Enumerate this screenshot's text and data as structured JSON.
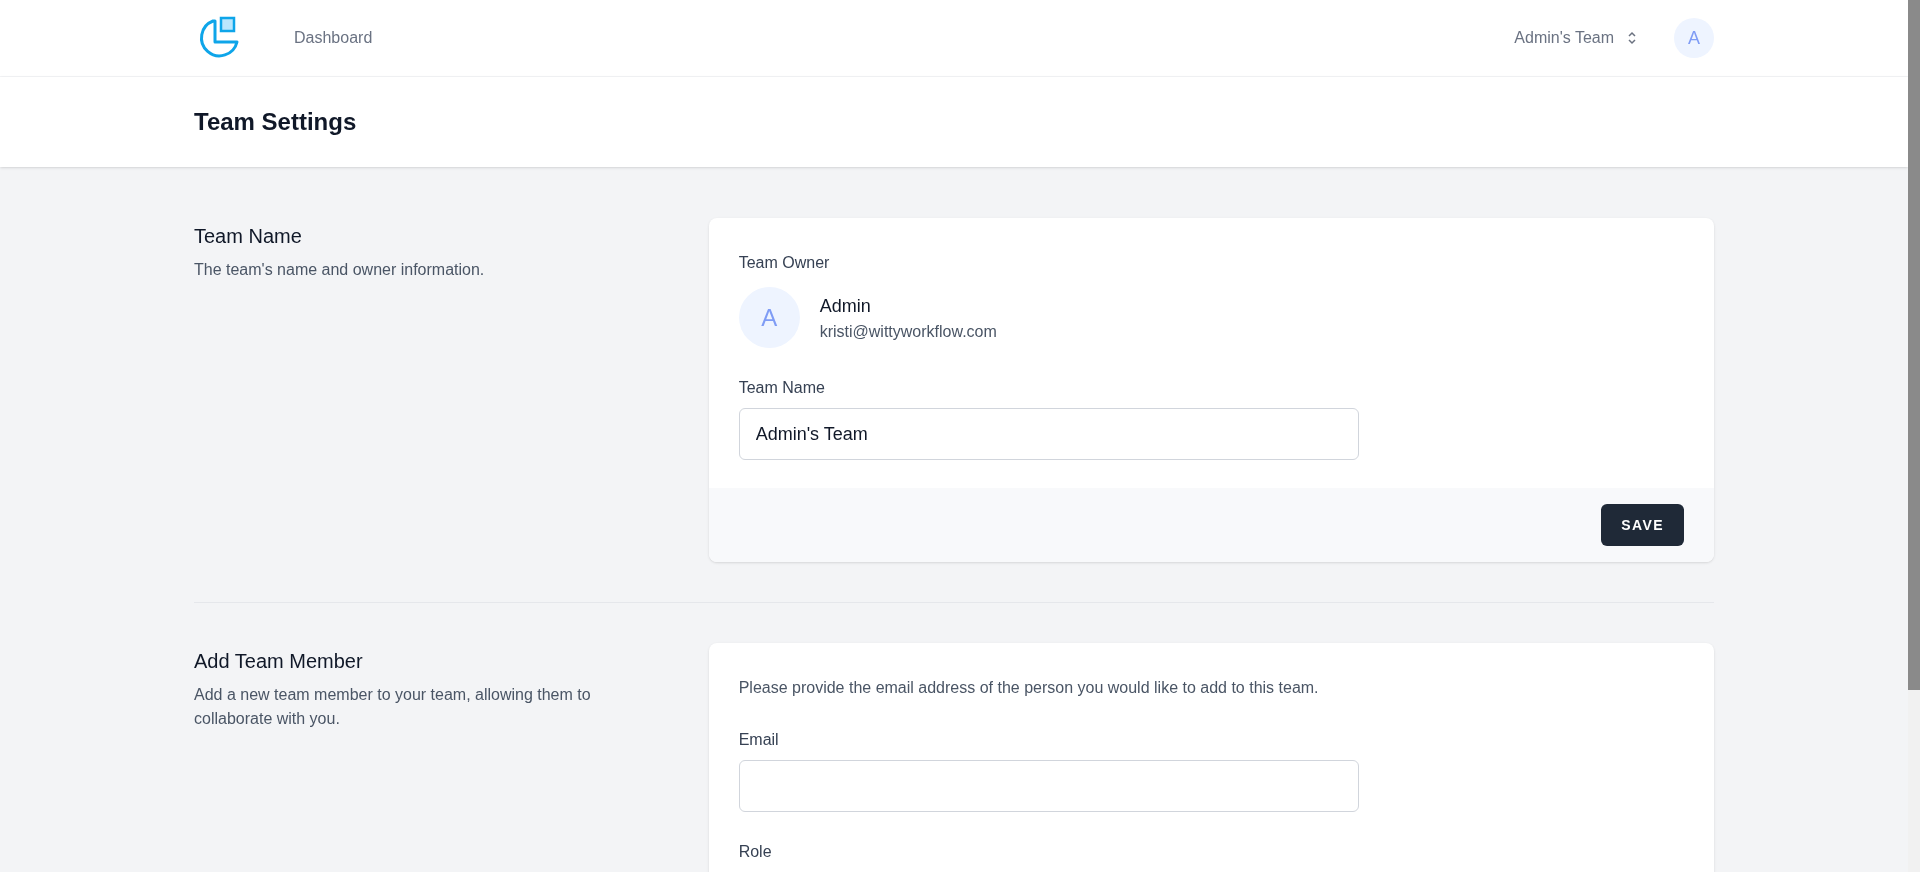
{
  "nav": {
    "links": [
      {
        "label": "Dashboard",
        "selected": false
      }
    ],
    "team_switcher": "Admin's Team",
    "avatar": "A"
  },
  "header": {
    "title": "Team Settings"
  },
  "sections": [
    {
      "kind": "team_name",
      "title": "Team Name",
      "description": "The team's name and owner information.",
      "owner_label": "Team Owner",
      "owner": {
        "avatar": "A",
        "name": "Admin",
        "email": "kristi@wittyworkflow.com"
      },
      "field_label": "Team Name",
      "field_value": "Admin's Team",
      "button": "SAVE"
    },
    {
      "kind": "add_member",
      "title": "Add Team Member",
      "description": "Add a new team member to your team, allowing them to collaborate with you.",
      "intro": "Please provide the email address of the person you would like to add to this team.",
      "email_label": "Email",
      "role_label": "Role"
    }
  ]
}
